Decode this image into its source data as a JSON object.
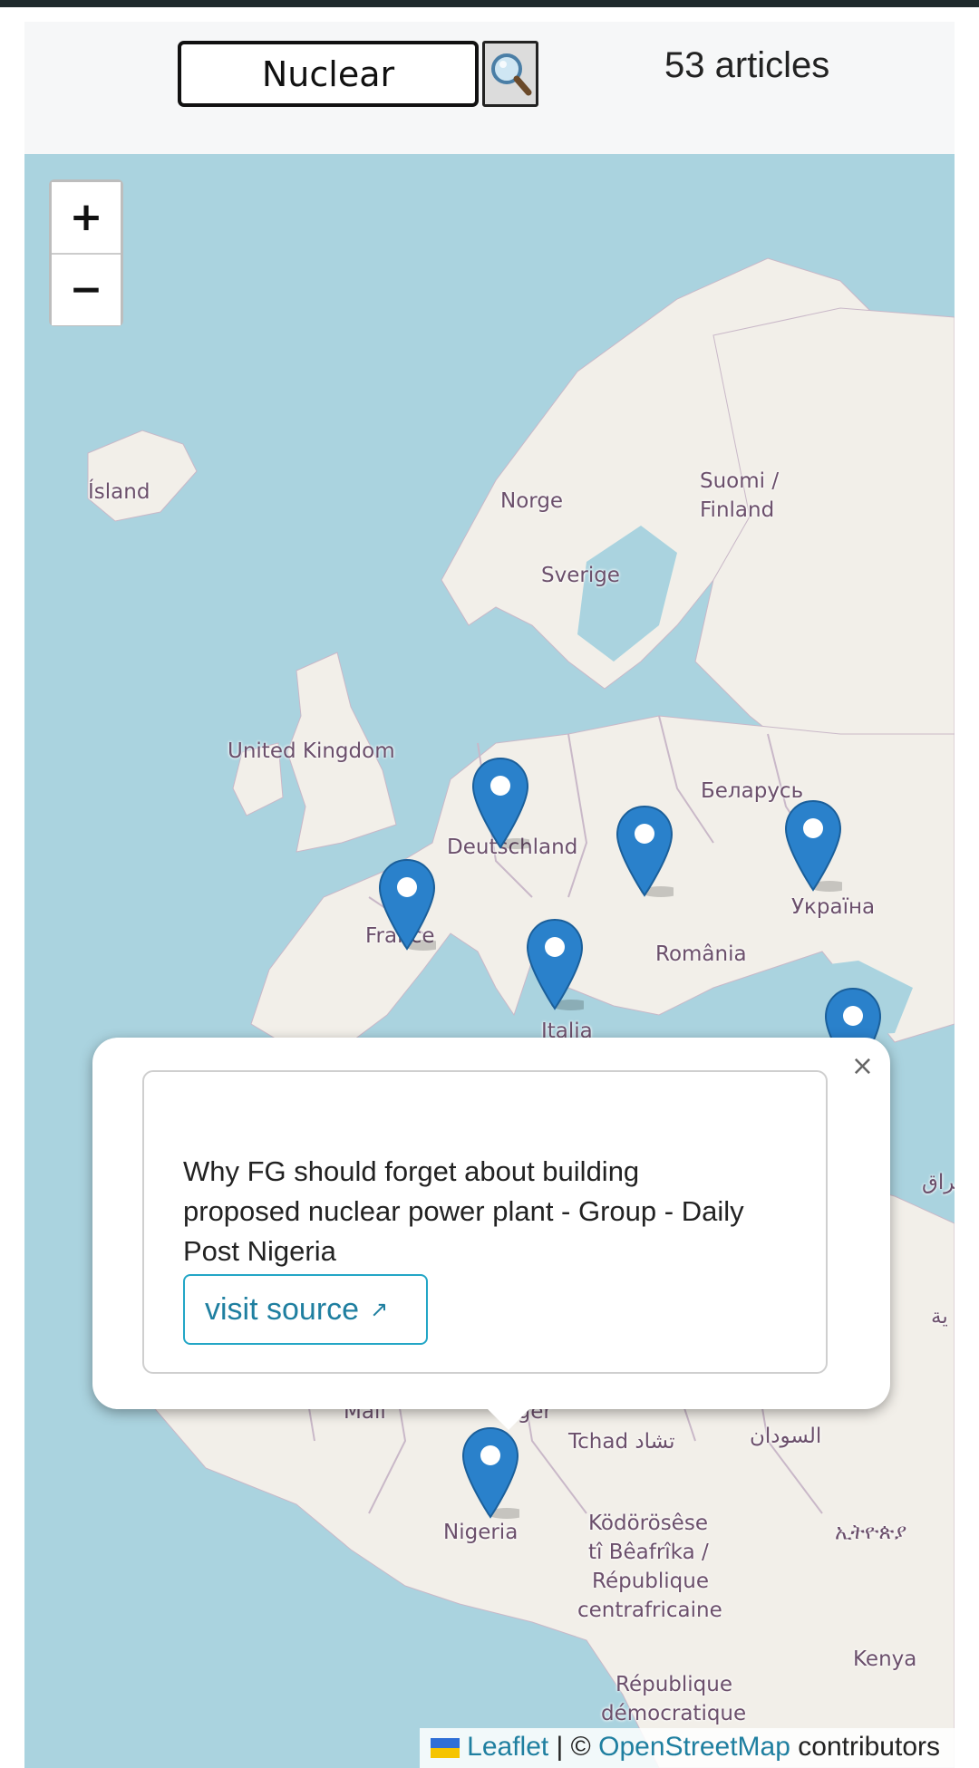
{
  "search": {
    "value": "Nuclear",
    "button_icon": "search-icon"
  },
  "count_label": "53 articles",
  "map": {
    "zoom_in": "+",
    "zoom_out": "−",
    "labels": {
      "island": "Ísland",
      "norge": "Norge",
      "suomi": "Suomi /",
      "finland": "Finland",
      "sverige": "Sverige",
      "uk": "United Kingdom",
      "belarus": "Беларусь",
      "deutschland": "Deutschland",
      "ukraina": "Україна",
      "france": "France",
      "romania": "România",
      "italia": "Italia",
      "mali": "Mali",
      "niger": "Niger",
      "tchad": "Tchad تشاد",
      "sudan": "السودان",
      "nigeria": "Nigeria",
      "car1": "Ködörösêse",
      "car2": "tî Bêafrîka /",
      "car3": "République",
      "car4": "centrafricaine",
      "ethiopia": "ኢትዮጵያ",
      "kenya": "Kenya",
      "drc1": "République",
      "drc2": "démocratique",
      "iraq": "عراق",
      "arabic_e": "ية"
    }
  },
  "popup": {
    "close": "×",
    "title": "Why FG should forget about building proposed nuclear power plant - Group - Daily Post Nigeria",
    "link_label": "visit source",
    "link_arrow": "↗"
  },
  "attribution": {
    "leaflet": "Leaflet",
    "separator": " | © ",
    "osm": "OpenStreetMap",
    "suffix": " contributors"
  },
  "colors": {
    "marker": "#2a81cb",
    "water": "#aad3df",
    "land": "#f2efe9",
    "link": "#1f7fa0"
  }
}
